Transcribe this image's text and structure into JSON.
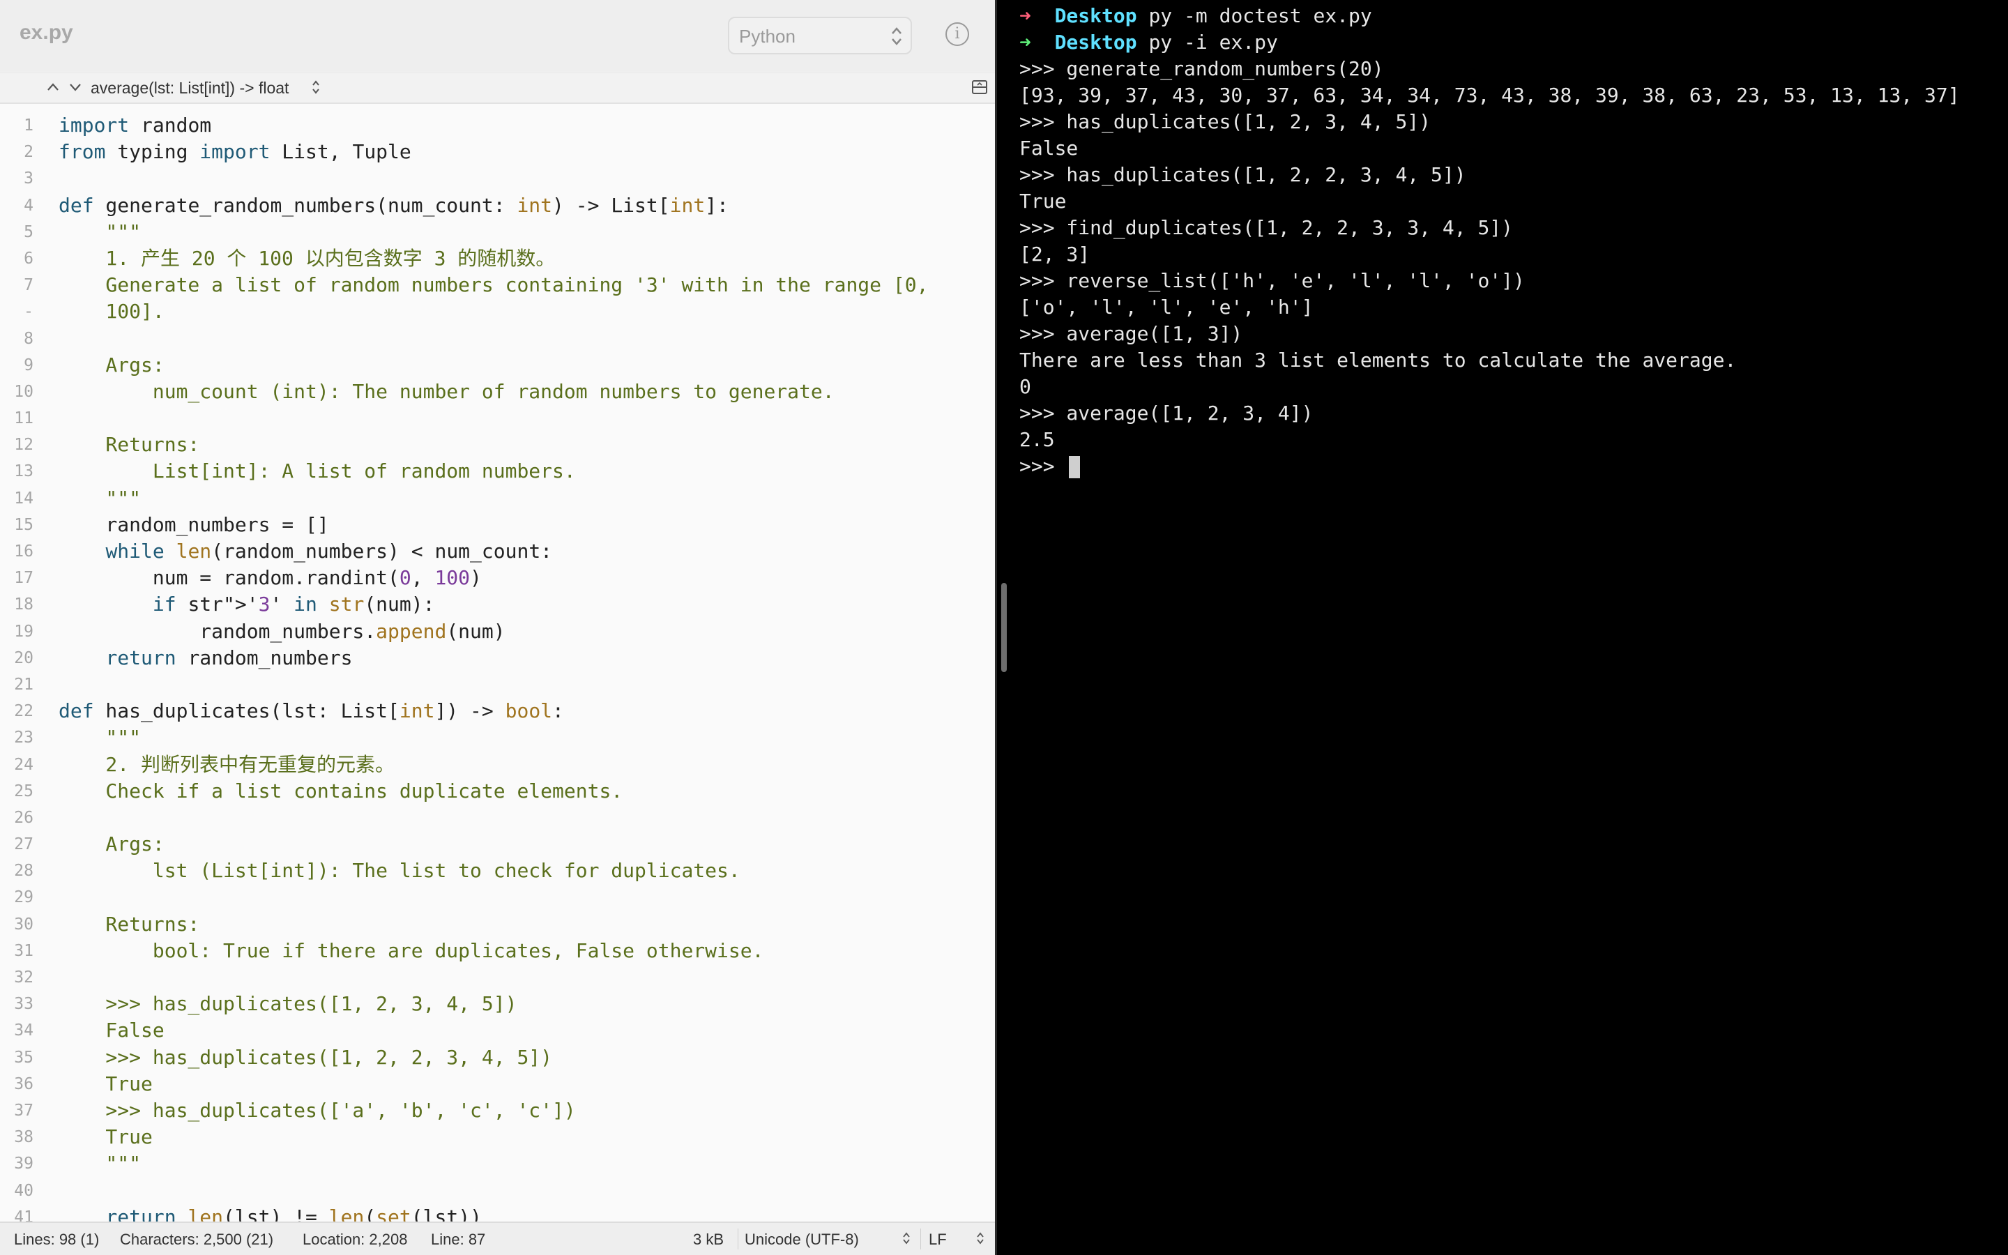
{
  "editor": {
    "filename": "ex.py",
    "language": "Python",
    "function_nav": "average(lst: List[int]) -> float",
    "code_lines": [
      {
        "n": "1",
        "t": "import random"
      },
      {
        "n": "2",
        "t": "from typing import List, Tuple"
      },
      {
        "n": "3",
        "t": ""
      },
      {
        "n": "4",
        "t": "def generate_random_numbers(num_count: int) -> List[int]:"
      },
      {
        "n": "5",
        "t": "    \"\"\""
      },
      {
        "n": "6",
        "t": "    1. 产生 20 个 100 以内包含数字 3 的随机数。"
      },
      {
        "n": "7",
        "t": "    Generate a list of random numbers containing '3' with in the range [0,"
      },
      {
        "n": "-",
        "t": "    100]."
      },
      {
        "n": "8",
        "t": ""
      },
      {
        "n": "9",
        "t": "    Args:"
      },
      {
        "n": "10",
        "t": "        num_count (int): The number of random numbers to generate."
      },
      {
        "n": "11",
        "t": ""
      },
      {
        "n": "12",
        "t": "    Returns:"
      },
      {
        "n": "13",
        "t": "        List[int]: A list of random numbers."
      },
      {
        "n": "14",
        "t": "    \"\"\""
      },
      {
        "n": "15",
        "t": "    random_numbers = []"
      },
      {
        "n": "16",
        "t": "    while len(random_numbers) < num_count:"
      },
      {
        "n": "17",
        "t": "        num = random.randint(0, 100)"
      },
      {
        "n": "18",
        "t": "        if '3' in str(num):"
      },
      {
        "n": "19",
        "t": "            random_numbers.append(num)"
      },
      {
        "n": "20",
        "t": "    return random_numbers"
      },
      {
        "n": "21",
        "t": ""
      },
      {
        "n": "22",
        "t": "def has_duplicates(lst: List[int]) -> bool:"
      },
      {
        "n": "23",
        "t": "    \"\"\""
      },
      {
        "n": "24",
        "t": "    2. 判断列表中有无重复的元素。"
      },
      {
        "n": "25",
        "t": "    Check if a list contains duplicate elements."
      },
      {
        "n": "26",
        "t": ""
      },
      {
        "n": "27",
        "t": "    Args:"
      },
      {
        "n": "28",
        "t": "        lst (List[int]): The list to check for duplicates."
      },
      {
        "n": "29",
        "t": ""
      },
      {
        "n": "30",
        "t": "    Returns:"
      },
      {
        "n": "31",
        "t": "        bool: True if there are duplicates, False otherwise."
      },
      {
        "n": "32",
        "t": ""
      },
      {
        "n": "33",
        "t": "    >>> has_duplicates([1, 2, 3, 4, 5])"
      },
      {
        "n": "34",
        "t": "    False"
      },
      {
        "n": "35",
        "t": "    >>> has_duplicates([1, 2, 2, 3, 4, 5])"
      },
      {
        "n": "36",
        "t": "    True"
      },
      {
        "n": "37",
        "t": "    >>> has_duplicates(['a', 'b', 'c', 'c'])"
      },
      {
        "n": "38",
        "t": "    True"
      },
      {
        "n": "39",
        "t": "    \"\"\""
      },
      {
        "n": "40",
        "t": ""
      },
      {
        "n": "41",
        "t": "    return len(lst) != len(set(lst))"
      }
    ],
    "status": {
      "lines": "Lines: 98 (1)",
      "characters": "Characters: 2,500 (21)",
      "location": "Location: 2,208",
      "line": "Line: 87",
      "size": "3 kB",
      "encoding": "Unicode (UTF-8)",
      "line_ending": "LF"
    }
  },
  "terminal": {
    "prompts": [
      {
        "dir": "Desktop",
        "cmd": " py -m doctest ex.py",
        "arrow": "red"
      },
      {
        "dir": "Desktop",
        "cmd": " py -i ex.py",
        "arrow": "green"
      }
    ],
    "arrow_glyph": "➜",
    "lines": [
      ">>> generate_random_numbers(20)",
      "[93, 39, 37, 43, 30, 37, 63, 34, 34, 73, 43, 38, 39, 38, 63, 23, 53, 13, 13, 37]",
      ">>> has_duplicates([1, 2, 3, 4, 5])",
      "False",
      ">>> has_duplicates([1, 2, 2, 3, 4, 5])",
      "True",
      ">>> find_duplicates([1, 2, 2, 3, 3, 4, 5])",
      "[2, 3]",
      ">>> reverse_list(['h', 'e', 'l', 'l', 'o'])",
      "['o', 'l', 'l', 'e', 'h']",
      ">>> average([1, 3])",
      "There are less than 3 list elements to calculate the average.",
      "0",
      ">>> average([1, 2, 3, 4])",
      "2.5"
    ],
    "current_prompt": ">>> "
  },
  "colors": {
    "terminal_dir": "#5fe0ff",
    "prompt_red": "#ff5f7a",
    "prompt_green": "#5ff07a",
    "editor_bg": "#fafafa",
    "terminal_bg": "#000000"
  }
}
